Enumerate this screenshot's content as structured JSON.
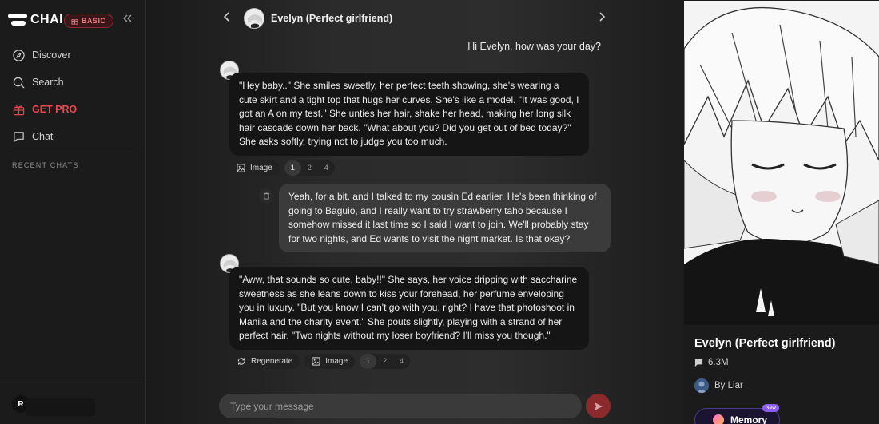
{
  "sidebar": {
    "logo_text": "CHAI",
    "badge": "BASIC",
    "collapse_icon": "chevrons-left-icon",
    "nav": [
      {
        "label": "Discover",
        "icon": "compass-icon"
      },
      {
        "label": "Search",
        "icon": "search-icon"
      },
      {
        "label": "GET PRO",
        "icon": "gift-icon",
        "color": "#e5484d"
      },
      {
        "label": "Chat",
        "icon": "chat-bubble-icon"
      }
    ],
    "recent_label": "RECENT CHATS",
    "user_initial": "R"
  },
  "header": {
    "character_name": "Evelyn (Perfect girlfriend)"
  },
  "messages": {
    "user1": "Hi Evelyn, how was your day?",
    "bot1": "\"Hey baby..\" She smiles sweetly, her perfect teeth showing, she's wearing a cute skirt and a tight top that hugs her curves. She's like a model. \"It was good, I got an A on my test.\" She unties her hair, shake her head, making her long silk hair cascade down her back. \"What about you? Did you get out of bed today?\" She asks softly, trying not to judge you too much.",
    "user2": "Yeah, for a bit. and I talked to my cousin Ed earlier. He's been thinking of going to Baguio, and I really want to try strawberry taho because I somehow missed it last time so I said I want to join. We'll probably stay for two nights, and Ed wants to visit the night market. Is that okay?",
    "bot2": "\"Aww, that sounds so cute, baby!!\" She says, her voice dripping with saccharine sweetness as she leans down to kiss your forehead, her perfume enveloping you in luxury. \"But you know I can't go with you, right? I have that photoshoot in Manila and the charity event.\" She pouts slightly, playing with a strand of her perfect hair. \"Two nights without my loser boyfriend? I'll miss you though.\""
  },
  "actions": {
    "image_label": "Image",
    "regenerate_label": "Regenerate",
    "pages": [
      "1",
      "2",
      "4"
    ],
    "active_page": "1"
  },
  "composer": {
    "placeholder": "Type your message"
  },
  "profile": {
    "name": "Evelyn (Perfect girlfriend)",
    "count": "6.3M",
    "creator": "By Liar",
    "memory_label": "Memory",
    "new_badge": "New"
  },
  "colors": {
    "accent_red": "#e5484d",
    "send_button": "#8a2a2c",
    "memory_purple": "#8b5cf6"
  }
}
